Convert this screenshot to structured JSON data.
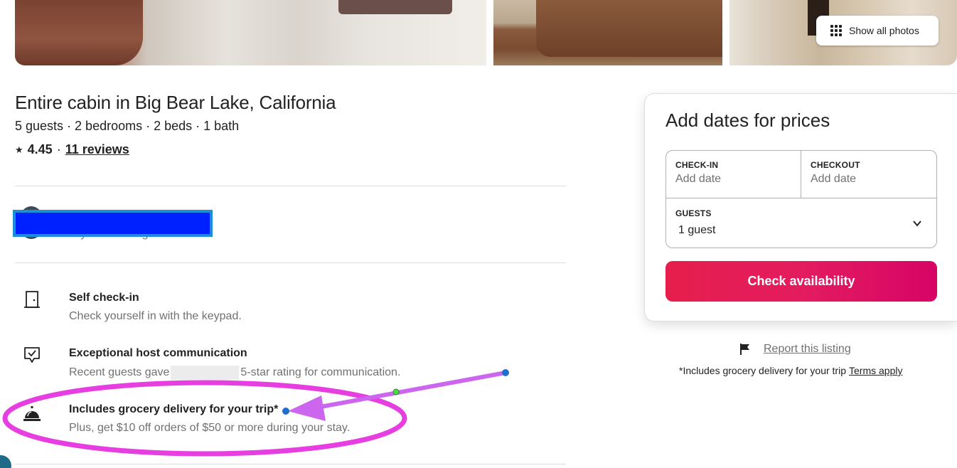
{
  "gallery": {
    "show_all_label": "Show all photos",
    "show_all_icon": "grid-dots-icon"
  },
  "listing": {
    "title": "Entire cabin in Big Bear Lake, California",
    "subtitle": "5 guests · 2 bedrooms · 2 beds · 1 bath",
    "rating_star": "★",
    "rating": "4.45",
    "rating_sep": "·",
    "reviews_link": "11 reviews"
  },
  "host": {
    "subtitle": "4 years hosting"
  },
  "amenities": [
    {
      "icon": "door-icon",
      "title": "Self check-in",
      "desc": "Check yourself in with the keypad."
    },
    {
      "icon": "chat-check-icon",
      "title": "Exceptional host communication",
      "desc_before": "Recent guests gave",
      "desc_after": "5-star rating for communication."
    },
    {
      "icon": "service-bell-icon",
      "title": "Includes grocery delivery for your trip*",
      "desc": "Plus, get $10 off orders of $50 or more during your stay."
    }
  ],
  "booking": {
    "title": "Add dates for prices",
    "checkin_label": "CHECK-IN",
    "checkin_value": "Add date",
    "checkout_label": "CHECKOUT",
    "checkout_value": "Add date",
    "guests_label": "GUESTS",
    "guests_value": "1 guest",
    "button_label": "Check availability"
  },
  "report": {
    "icon": "flag-icon",
    "label": "Report this listing"
  },
  "grocery_note": {
    "text": "*Includes grocery delivery for your trip",
    "terms": "Terms apply"
  },
  "colors": {
    "brand": "#e31c5f",
    "annotation": "#d966f2",
    "redaction": "#0021ff"
  }
}
